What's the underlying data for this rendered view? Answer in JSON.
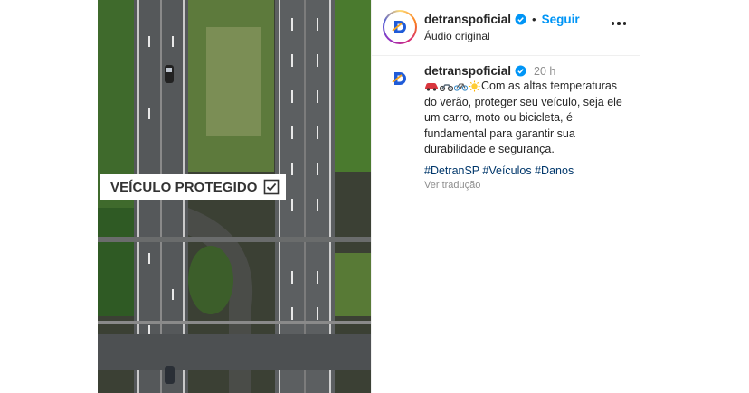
{
  "post": {
    "image": {
      "overlay_text": "VEÍCULO PROTEGIDO",
      "checkbox_icon": "checkbox-checked-icon"
    },
    "header": {
      "username": "detranspoficial",
      "follow_label": "Seguir",
      "separator": "•",
      "audio_label": "Áudio original",
      "more_icon": "more-options-icon"
    },
    "caption": {
      "username": "detranspoficial",
      "time": "20 h",
      "emoji_icons": [
        "car-emoji",
        "motorcycle-emoji",
        "bicycle-emoji",
        "sun-emoji"
      ],
      "text": "Com as altas temperaturas do verão, proteger seu veículo, seja ele um carro, moto ou bicicleta, é fundamental para garantir sua durabilidade e segurança.",
      "hashtags": [
        "#DetranSP",
        "#Veículos",
        "#Danos"
      ],
      "translate_label": "Ver tradução"
    },
    "colors": {
      "follow_blue": "#0095f6",
      "hashtag_blue": "#00376b",
      "verified_blue": "#0095f6",
      "brand_blue": "#1f5bd8"
    }
  }
}
